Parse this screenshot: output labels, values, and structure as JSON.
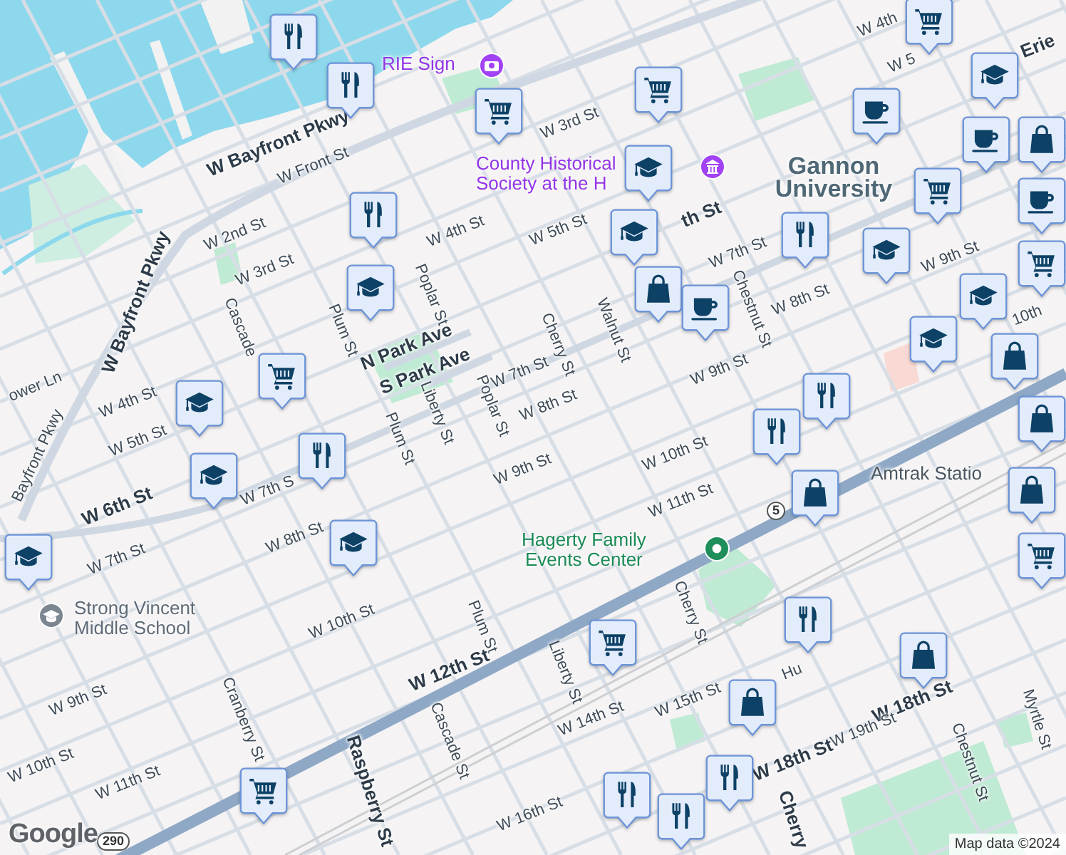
{
  "map": {
    "labels": [
      {
        "text": "W 4th",
        "kind": "street"
      },
      {
        "text": "W 5",
        "kind": "street"
      },
      {
        "text": "Erie",
        "kind": "major"
      },
      {
        "text": "W Bayfront Pkwy",
        "kind": "major"
      },
      {
        "text": "W Front St",
        "kind": "street"
      },
      {
        "text": "W 3rd St",
        "kind": "street"
      },
      {
        "text": "W 4th St",
        "kind": "street"
      },
      {
        "text": "W 5th St",
        "kind": "street"
      },
      {
        "text": "th St",
        "kind": "major"
      },
      {
        "text": "W 7th St",
        "kind": "street"
      },
      {
        "text": "W 8th St",
        "kind": "street"
      },
      {
        "text": "W 9th St",
        "kind": "street"
      },
      {
        "text": "10th",
        "kind": "street"
      },
      {
        "text": "W 2nd St",
        "kind": "street"
      },
      {
        "text": "W 3rd St",
        "kind": "street"
      },
      {
        "text": "W Bayfront Pkwy",
        "kind": "major"
      },
      {
        "text": "Cascade",
        "kind": "street"
      },
      {
        "text": "Plum St",
        "kind": "street"
      },
      {
        "text": "Poplar St",
        "kind": "street"
      },
      {
        "text": "Cherry St",
        "kind": "street"
      },
      {
        "text": "Walnut St",
        "kind": "street"
      },
      {
        "text": "Chestnut St",
        "kind": "street"
      },
      {
        "text": "N Park Ave",
        "kind": "major"
      },
      {
        "text": "S Park Ave",
        "kind": "major"
      },
      {
        "text": "W 7th St",
        "kind": "street"
      },
      {
        "text": "W 8th St",
        "kind": "street"
      },
      {
        "text": "W 9th St",
        "kind": "street"
      },
      {
        "text": "ower Ln",
        "kind": "street"
      },
      {
        "text": "W 4th St",
        "kind": "street"
      },
      {
        "text": "Liberty St",
        "kind": "street"
      },
      {
        "text": "Plum St",
        "kind": "street"
      },
      {
        "text": "Poplar St",
        "kind": "street"
      },
      {
        "text": "W 5th St",
        "kind": "street"
      },
      {
        "text": "Bayfront Pkwy",
        "kind": "street"
      },
      {
        "text": "W 6th St",
        "kind": "major"
      },
      {
        "text": "W 7th S",
        "kind": "street"
      },
      {
        "text": "W 9th St",
        "kind": "street"
      },
      {
        "text": "W 10th St",
        "kind": "street"
      },
      {
        "text": "W 11th St",
        "kind": "street"
      },
      {
        "text": "W 8th St",
        "kind": "street"
      },
      {
        "text": "W 7th St",
        "kind": "street"
      },
      {
        "text": "W 10th St",
        "kind": "street"
      },
      {
        "text": "Plum St",
        "kind": "street"
      },
      {
        "text": "Cherry St",
        "kind": "street"
      },
      {
        "text": "Hu",
        "kind": "street"
      },
      {
        "text": "W 12th St",
        "kind": "major"
      },
      {
        "text": "Liberty St",
        "kind": "street"
      },
      {
        "text": "W 9th St",
        "kind": "street"
      },
      {
        "text": "W 15th St",
        "kind": "street"
      },
      {
        "text": "W 18th St",
        "kind": "major"
      },
      {
        "text": "Myrtle St",
        "kind": "street"
      },
      {
        "text": "W 14th St",
        "kind": "street"
      },
      {
        "text": "Cranberry St",
        "kind": "street"
      },
      {
        "text": "Cascade St",
        "kind": "street"
      },
      {
        "text": "W 19th St",
        "kind": "street"
      },
      {
        "text": "W 18th St",
        "kind": "major"
      },
      {
        "text": "Chestnut St",
        "kind": "street"
      },
      {
        "text": "W 10th St",
        "kind": "street"
      },
      {
        "text": "W 11th St",
        "kind": "street"
      },
      {
        "text": "Raspberry St",
        "kind": "major"
      },
      {
        "text": "W 16th St",
        "kind": "street"
      },
      {
        "text": "Cherry",
        "kind": "major"
      },
      {
        "text": "Gannon University",
        "kind": "place"
      },
      {
        "text": "Amtrak Statio",
        "kind": "transit"
      }
    ],
    "pois": [
      {
        "lines": [
          "RIE Sign"
        ],
        "kind": "attraction"
      },
      {
        "lines": [
          "County Historical",
          "Society at the H"
        ],
        "kind": "museum"
      },
      {
        "lines": [
          "Hagerty Family",
          "Events Center"
        ],
        "kind": "venue"
      },
      {
        "lines": [
          "Strong Vincent",
          "Middle School"
        ],
        "kind": "school"
      }
    ],
    "markers": [
      {
        "kind": "restaurant"
      },
      {
        "kind": "restaurant"
      },
      {
        "kind": "cart"
      },
      {
        "kind": "cart"
      },
      {
        "kind": "coffee"
      },
      {
        "kind": "education"
      },
      {
        "kind": "cart"
      },
      {
        "kind": "coffee"
      },
      {
        "kind": "bag"
      },
      {
        "kind": "coffee"
      },
      {
        "kind": "education"
      },
      {
        "kind": "education"
      },
      {
        "kind": "cart"
      },
      {
        "kind": "restaurant"
      },
      {
        "kind": "restaurant"
      },
      {
        "kind": "education"
      },
      {
        "kind": "cart"
      },
      {
        "kind": "education"
      },
      {
        "kind": "bag"
      },
      {
        "kind": "coffee"
      },
      {
        "kind": "education"
      },
      {
        "kind": "education"
      },
      {
        "kind": "bag"
      },
      {
        "kind": "cart"
      },
      {
        "kind": "restaurant"
      },
      {
        "kind": "bag"
      },
      {
        "kind": "education"
      },
      {
        "kind": "restaurant"
      },
      {
        "kind": "education"
      },
      {
        "kind": "restaurant"
      },
      {
        "kind": "bag"
      },
      {
        "kind": "bag"
      },
      {
        "kind": "education"
      },
      {
        "kind": "education"
      },
      {
        "kind": "cart"
      },
      {
        "kind": "cart"
      },
      {
        "kind": "bag"
      },
      {
        "kind": "restaurant"
      },
      {
        "kind": "bag"
      },
      {
        "kind": "restaurant"
      },
      {
        "kind": "cart"
      },
      {
        "kind": "restaurant"
      },
      {
        "kind": "restaurant"
      }
    ],
    "route_shields": [
      {
        "text": "5"
      },
      {
        "text": "290"
      }
    ],
    "logo": "Google",
    "attribution": "Map data ©2024"
  }
}
